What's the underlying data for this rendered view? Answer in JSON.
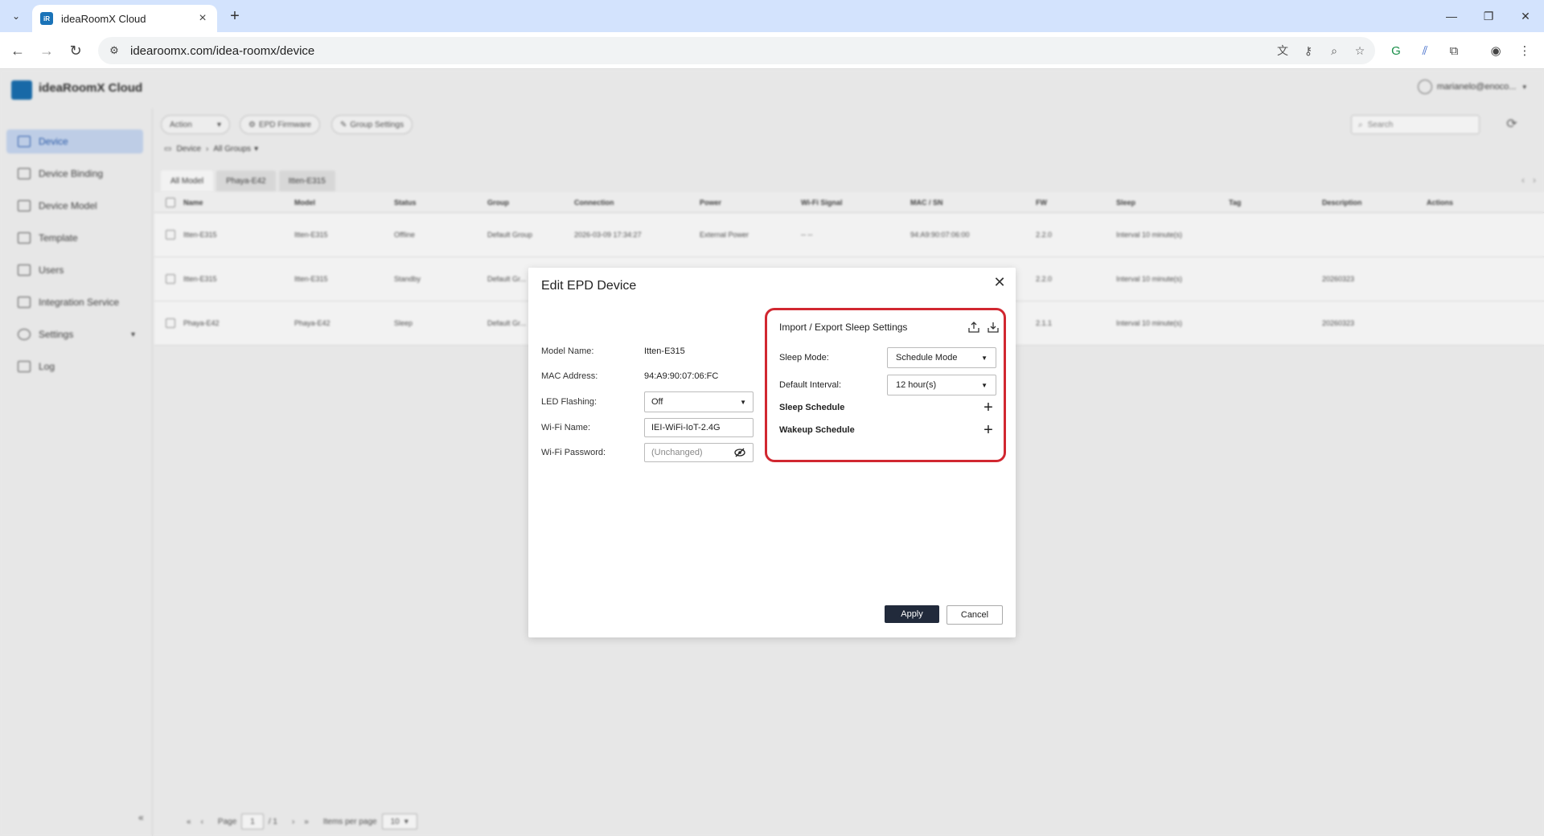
{
  "browser": {
    "tab_title": "ideaRoomX Cloud",
    "url": "idearoomx.com/idea-roomx/device"
  },
  "app": {
    "logo_text": "ideaRoomX Cloud",
    "user": "marianelo@enoco...",
    "sidebar": [
      {
        "label": "Device",
        "active": true
      },
      {
        "label": "Device Binding"
      },
      {
        "label": "Device Model"
      },
      {
        "label": "Template"
      },
      {
        "label": "Users"
      },
      {
        "label": "Integration Service"
      },
      {
        "label": "Settings"
      },
      {
        "label": "Log"
      }
    ],
    "toolbar": {
      "action": "Action",
      "epd_firmware": "EPD Firmware",
      "group_settings": "Group Settings",
      "search_placeholder": "Search"
    },
    "breadcrumb": {
      "root": "Device",
      "group": "All Groups"
    },
    "tabs": [
      "All Model",
      "Phaya-E42",
      "Itten-E315"
    ],
    "table": {
      "headers": [
        "Name",
        "Model",
        "Status",
        "Group",
        "Connection",
        "Power",
        "Wi-Fi Signal",
        "MAC / SN",
        "FW",
        "Sleep",
        "Tag",
        "Description",
        "Actions"
      ],
      "rows": [
        [
          "Itten-E315",
          "Itten-E315",
          "Offline",
          "Default Group",
          "2026-03-09 17:34:27",
          "External Power",
          "-- --",
          "94:A9:90:07:06:00",
          "2.2.0",
          "Interval 10 minute(s)",
          "",
          "",
          ""
        ],
        [
          "Itten-E315",
          "Itten-E315",
          "Standby",
          "Default Gr...",
          "",
          "",
          "",
          "",
          "2.2.0",
          "Interval 10 minute(s)",
          "",
          "20260323",
          ""
        ],
        [
          "Phaya-E42",
          "Phaya-E42",
          "Sleep",
          "Default Gr...",
          "",
          "",
          "",
          "",
          "2.1.1",
          "Interval 10 minute(s)",
          "",
          "20260323",
          ""
        ]
      ]
    },
    "pager": {
      "page_label": "Page",
      "page": "1",
      "of": "/ 1",
      "items_label": "Items per page",
      "items": "10"
    }
  },
  "modal": {
    "title": "Edit EPD Device",
    "fields": {
      "model_name_label": "Model Name:",
      "model_name_value": "Itten-E315",
      "mac_label": "MAC Address:",
      "mac_value": "94:A9:90:07:06:FC",
      "led_label": "LED Flashing:",
      "led_value": "Off",
      "wifi_name_label": "Wi-Fi Name:",
      "wifi_name_value": "IEI-WiFi-IoT-2.4G",
      "wifi_password_label": "Wi-Fi Password:",
      "wifi_password_placeholder": "(Unchanged)"
    },
    "sleep": {
      "title": "Import / Export Sleep Settings",
      "sleep_mode_label": "Sleep Mode:",
      "sleep_mode_value": "Schedule Mode",
      "default_interval_label": "Default Interval:",
      "default_interval_value": "12 hour(s)",
      "sleep_schedule_label": "Sleep Schedule",
      "wakeup_schedule_label": "Wakeup Schedule"
    },
    "apply": "Apply",
    "cancel": "Cancel",
    "highlight_color": "#d12730"
  }
}
